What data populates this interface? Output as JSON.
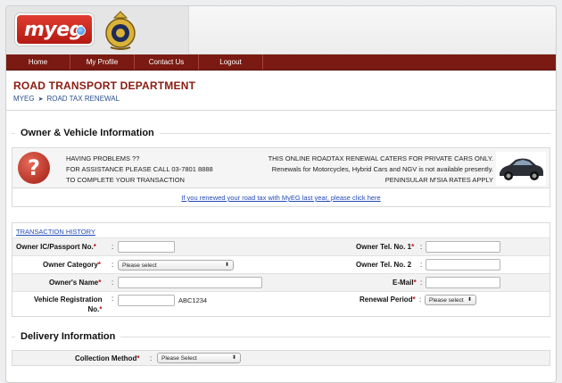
{
  "nav": {
    "items": [
      {
        "label": "Home"
      },
      {
        "label": "My Profile"
      },
      {
        "label": "Contact Us"
      },
      {
        "label": "Logout"
      }
    ]
  },
  "brand": {
    "logo_text": "myeg"
  },
  "header": {
    "title": "ROAD TRANSPORT DEPARTMENT",
    "breadcrumb": [
      "MYEG",
      "ROAD TAX RENEWAL"
    ]
  },
  "owner_section": {
    "title": "Owner & Vehicle Information",
    "notice_left": [
      "HAVING PROBLEMS ??",
      "FOR ASSISTANCE PLEASE CALL 03-7801 8888",
      "TO COMPLETE YOUR TRANSACTION"
    ],
    "notice_right": [
      "THIS ONLINE ROADTAX RENEWAL CATERS FOR PRIVATE CARS ONLY.",
      "Renewals for Motorcycles, Hybrid Cars and NGV is not available presently.",
      "PENINSULAR M'SIA RATES APPLY"
    ],
    "renew_link": "If you renewed your road tax with MyEG last year, please click here"
  },
  "form": {
    "history_link": "TRANSACTION HISTORY",
    "ic_label": "Owner IC/Passport No.",
    "tel1_label": "Owner Tel. No. 1",
    "category_label": "Owner Category",
    "category_value": "Please select",
    "tel2_label": "Owner Tel. No. 2",
    "name_label": "Owner's Name",
    "email_label": "E-Mail",
    "vehreg_label_1": "Vehicle Registration",
    "vehreg_label_2": "No.",
    "vehreg_value": "ABC1234",
    "period_label": "Renewal Period",
    "period_value": "Please select",
    "req_mark": "*",
    "colon": ":"
  },
  "delivery": {
    "title": "Delivery Information",
    "collection_label": "Collection Method",
    "collection_value": "Please Select"
  }
}
